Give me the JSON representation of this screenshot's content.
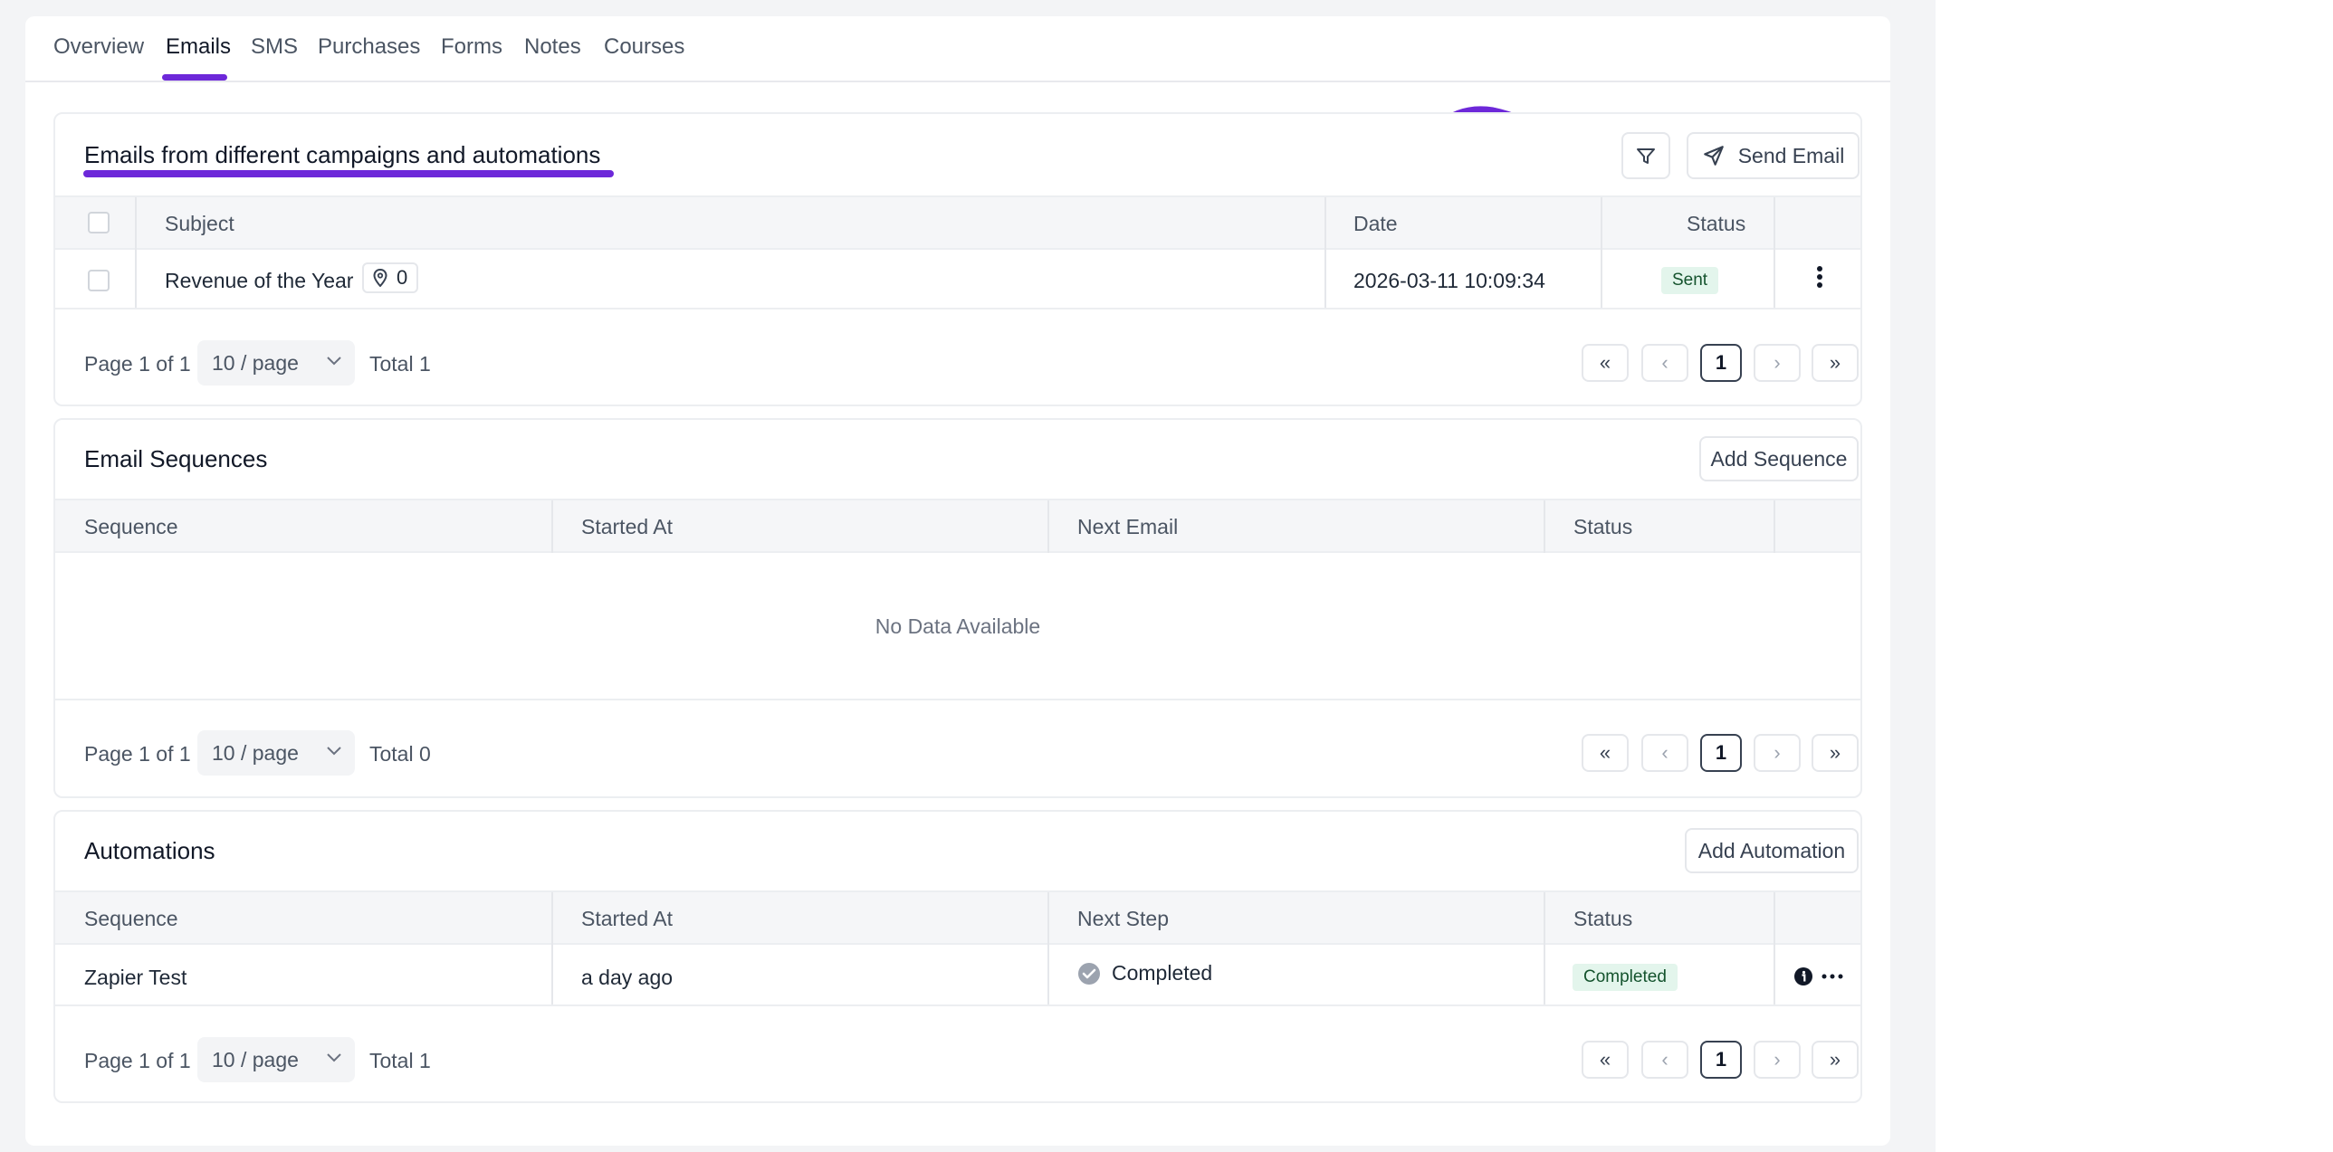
{
  "tabs": [
    "Overview",
    "Emails",
    "SMS",
    "Purchases",
    "Forms",
    "Notes",
    "Courses"
  ],
  "colors": {
    "accent": "#6d28d9",
    "badge_bg": "#e3f5ec",
    "badge_text": "#14532d"
  },
  "emails": {
    "title": "Emails from different campaigns and automations",
    "filter_icon": "filter-icon",
    "send_label": "Send Email",
    "columns": [
      "Subject",
      "Date",
      "Status"
    ],
    "rows": [
      {
        "subject": "Revenue of the Year",
        "location_count": "0",
        "date": "2026-03-11 10:09:34",
        "status": "Sent"
      }
    ],
    "footer": {
      "page_info": "Page 1 of 1",
      "per_page": "10 / page",
      "total": "Total 1",
      "current_page": "1"
    }
  },
  "sequences": {
    "title": "Email Sequences",
    "add_label": "Add Sequence",
    "columns": [
      "Sequence",
      "Started At",
      "Next Email",
      "Status"
    ],
    "empty_text": "No Data Available",
    "footer": {
      "page_info": "Page 1 of 1",
      "per_page": "10 / page",
      "total": "Total 0",
      "current_page": "1"
    }
  },
  "automations": {
    "title": "Automations",
    "add_label": "Add Automation",
    "columns": [
      "Sequence",
      "Started At",
      "Next Step",
      "Status"
    ],
    "rows": [
      {
        "sequence": "Zapier Test",
        "started_at": "a day ago",
        "next_step": "Completed",
        "status": "Completed"
      }
    ],
    "footer": {
      "page_info": "Page 1 of 1",
      "per_page": "10 / page",
      "total": "Total 1",
      "current_page": "1"
    }
  }
}
